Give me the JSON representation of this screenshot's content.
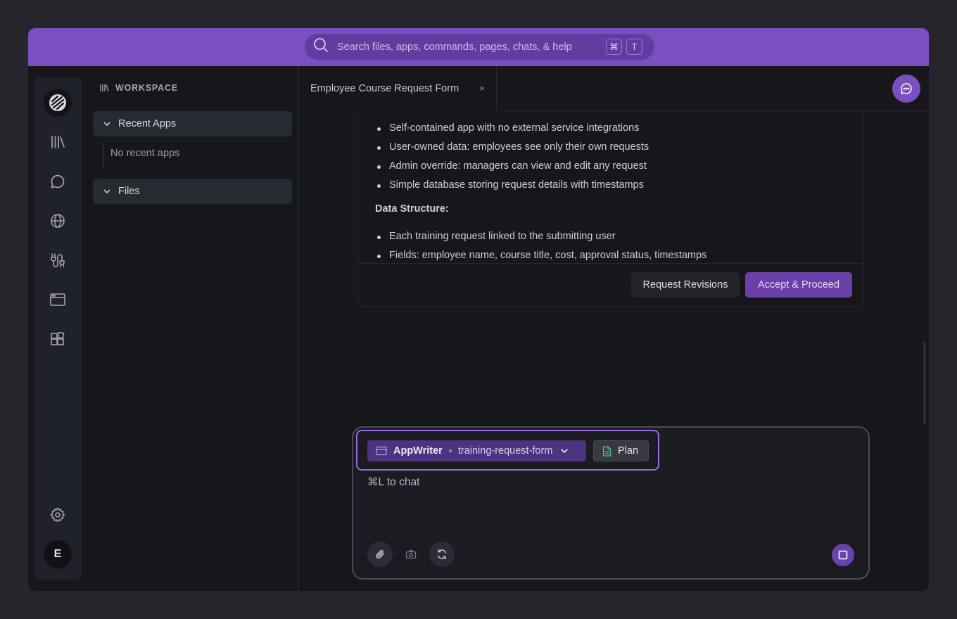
{
  "search": {
    "placeholder": "Search files, apps, commands, pages, chats, & help",
    "shortcut_keys": [
      "⌘",
      "T"
    ]
  },
  "rail": {
    "items": [
      "logo-icon",
      "library-icon",
      "chat-bubble-icon",
      "globe-icon",
      "integrations-icon",
      "browser-window-icon",
      "apps-grid-icon"
    ],
    "settings_icon": "gear-icon",
    "avatar_initial": "E"
  },
  "sidebar": {
    "header": "WORKSPACE",
    "sections": [
      {
        "label": "Recent Apps",
        "empty_text": "No recent apps"
      },
      {
        "label": "Files"
      }
    ]
  },
  "tabs": [
    {
      "label": "Employee Course Request Form",
      "close": "×"
    }
  ],
  "plan": {
    "bullets_top": [
      "Self-contained app with no external service integrations",
      "User-owned data: employees see only their own requests",
      "Admin override: managers can view and edit any request",
      "Simple database storing request details with timestamps"
    ],
    "data_structure_heading": "Data Structure:",
    "bullets_data": [
      "Each training request linked to the submitting user",
      "Fields: employee name, course title, cost, approval status, timestamps"
    ],
    "request_revisions": "Request Revisions",
    "accept": "Accept & Proceed"
  },
  "composer": {
    "app_name": "AppWriter",
    "project": "training-request-form",
    "plan_chip": "Plan",
    "prompt": "⌘L to chat"
  },
  "colors": {
    "accent": "#7b4fc0",
    "accent_dark": "#6a40a8",
    "background": "#16161b"
  }
}
